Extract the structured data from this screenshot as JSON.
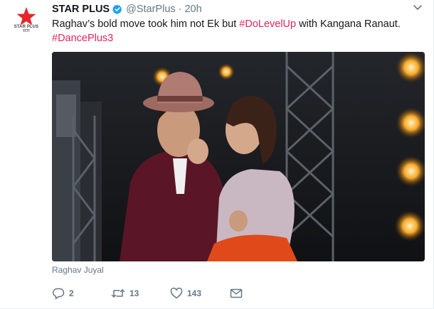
{
  "tweet": {
    "display_name": "STAR PLUS",
    "handle": "@StarPlus",
    "separator": "·",
    "time": "20h",
    "text_line1_before": "Raghav’s bold move took him not Ek but ",
    "hashtag1": "#DoLevelUp",
    "text_line1_after": " with Kangana Ranaut.",
    "hashtag2": "#DancePlus3",
    "media_caption": "Raghav Juyal"
  },
  "logo": {
    "line1": "STAR PLUS",
    "line2": "स्टार"
  },
  "actions": {
    "reply_count": "2",
    "retweet_count": "13",
    "like_count": "143"
  },
  "icons": {
    "avatar": "star-plus-logo",
    "verified": "verified-badge-icon",
    "menu": "chevron-down-icon",
    "reply": "reply-icon",
    "retweet": "retweet-icon",
    "like": "heart-icon",
    "message": "envelope-icon"
  },
  "colors": {
    "hashtag": "#e0245e",
    "verified": "#1da1f2",
    "star": "#e3262b",
    "muted": "#657786"
  }
}
